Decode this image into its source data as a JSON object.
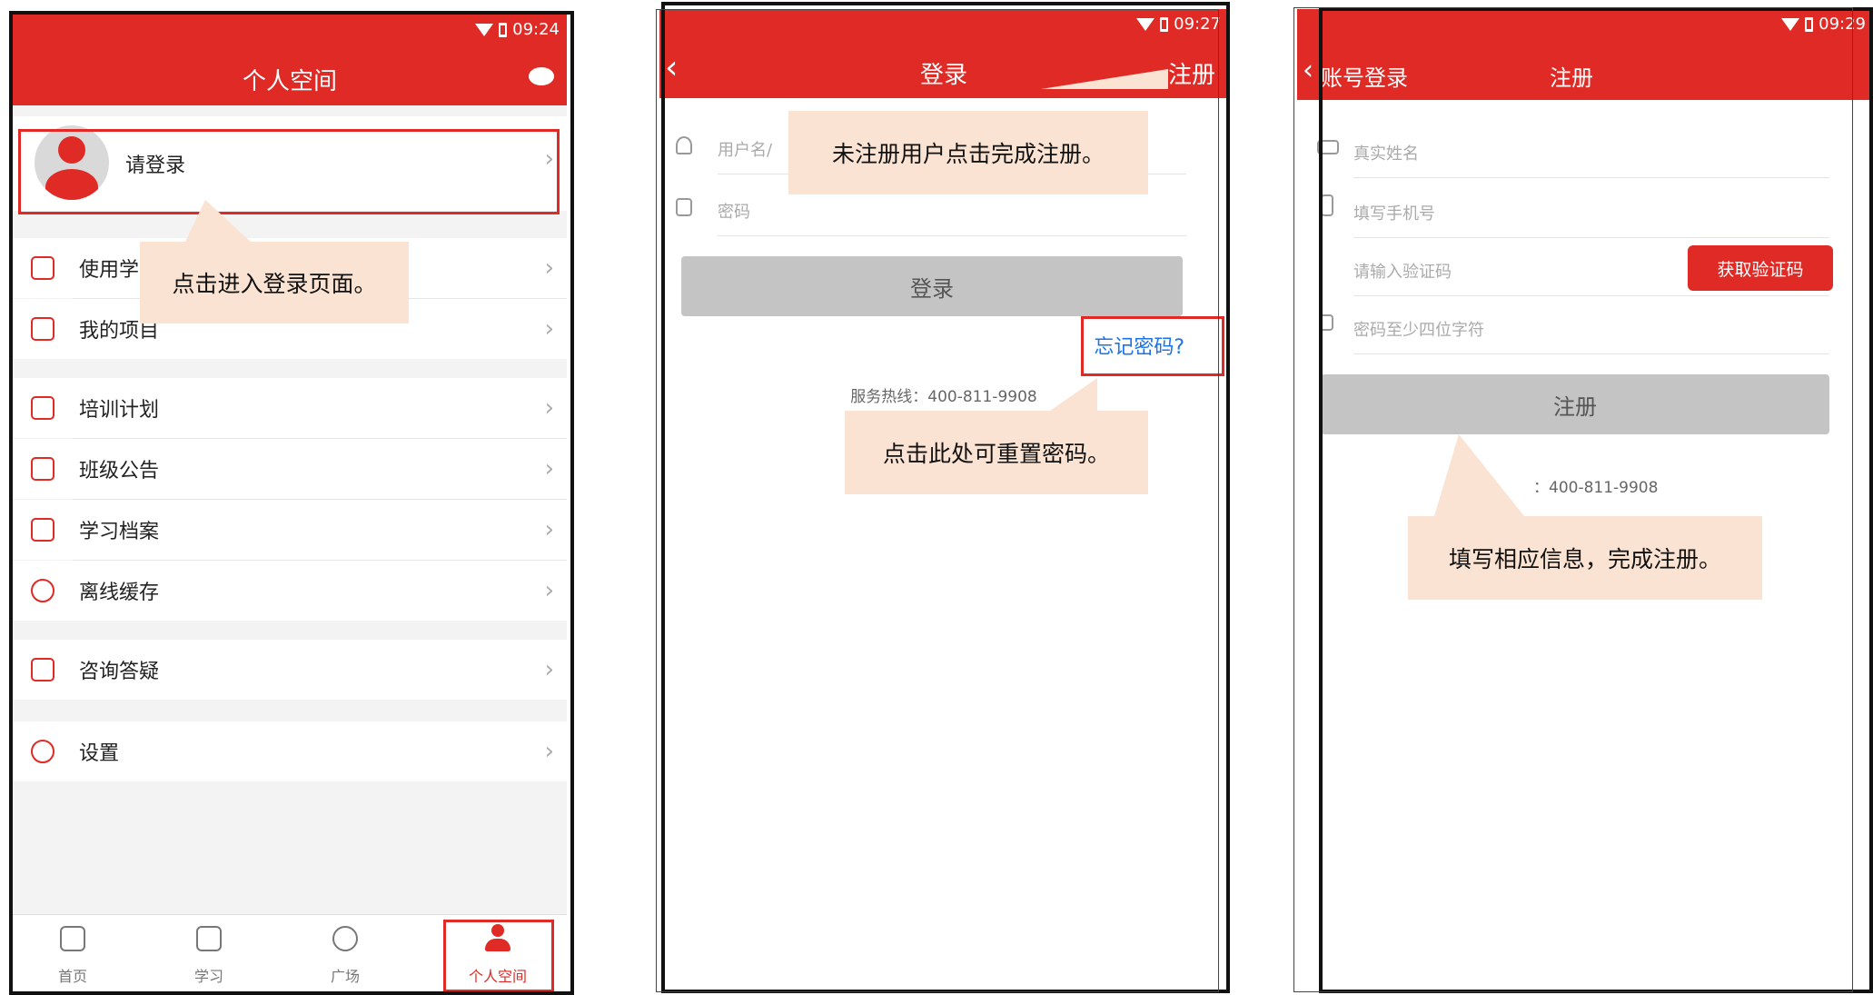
{
  "screen1": {
    "status_time": "09:24",
    "title": "个人空间",
    "login_prompt": "请登录",
    "menu": [
      {
        "label": "使用学",
        "icon": "guide-icon"
      },
      {
        "label": "我的项目",
        "icon": "list-icon"
      },
      {
        "label": "培训计划",
        "icon": "calendar-icon"
      },
      {
        "label": "班级公告",
        "icon": "speaker-icon"
      },
      {
        "label": "学习档案",
        "icon": "folder-icon"
      },
      {
        "label": "离线缓存",
        "icon": "cloud-download-icon"
      },
      {
        "label": "咨询答疑",
        "icon": "chat-icon"
      },
      {
        "label": "设置",
        "icon": "gear-icon"
      }
    ],
    "tabs": [
      {
        "label": "首页",
        "icon": "home-icon"
      },
      {
        "label": "学习",
        "icon": "book-icon"
      },
      {
        "label": "广场",
        "icon": "target-icon"
      },
      {
        "label": "个人空间",
        "icon": "user-icon"
      }
    ],
    "callout": "点击进入登录页面。"
  },
  "screen2": {
    "status_time": "09:27",
    "title": "登录",
    "register_link": "注册",
    "username_placeholder": "用户名/",
    "password_placeholder": "密码",
    "login_button": "登录",
    "forgot_password": "忘记密码?",
    "hotline": "服务热线：400-811-9908",
    "callout_register": "未注册用户点击完成注册。",
    "callout_reset": "点击此处可重置密码。"
  },
  "screen3": {
    "status_time": "09:29",
    "tab_account_login": "账号登录",
    "tab_register": "注册",
    "name_placeholder": "真实姓名",
    "phone_placeholder": "填写手机号",
    "code_placeholder": "请输入验证码",
    "get_code_button": "获取验证码",
    "password_placeholder": "密码至少四位字符",
    "register_button": "注册",
    "hotline": "：400-811-9908",
    "callout": "填写相应信息，完成注册。"
  },
  "colors": {
    "brand_red": "#e02a25",
    "callout_bg": "#fae3d2",
    "link_blue": "#1a73e8"
  }
}
